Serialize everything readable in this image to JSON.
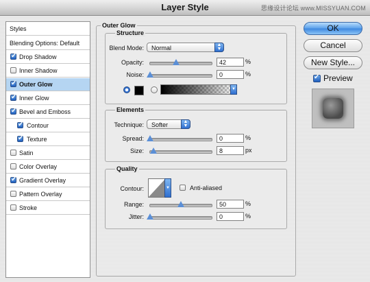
{
  "window": {
    "title": "Layer Style",
    "watermark": "思缘设计论坛 www.MISSYUAN.COM"
  },
  "sidebar": {
    "header": "Styles",
    "blending": "Blending Options: Default",
    "items": [
      {
        "label": "Drop Shadow",
        "checked": true
      },
      {
        "label": "Inner Shadow",
        "checked": false
      },
      {
        "label": "Outer Glow",
        "checked": true,
        "selected": true
      },
      {
        "label": "Inner Glow",
        "checked": true
      },
      {
        "label": "Bevel and Emboss",
        "checked": true
      },
      {
        "label": "Contour",
        "checked": true,
        "indent": true
      },
      {
        "label": "Texture",
        "checked": true,
        "indent": true
      },
      {
        "label": "Satin",
        "checked": false
      },
      {
        "label": "Color Overlay",
        "checked": false
      },
      {
        "label": "Gradient Overlay",
        "checked": true
      },
      {
        "label": "Pattern Overlay",
        "checked": false
      },
      {
        "label": "Stroke",
        "checked": false
      }
    ]
  },
  "outer_glow": {
    "title": "Outer Glow",
    "structure": {
      "title": "Structure",
      "blend_mode_label": "Blend Mode:",
      "blend_mode": "Normal",
      "opacity_label": "Opacity:",
      "opacity": "42",
      "opacity_unit": "%",
      "noise_label": "Noise:",
      "noise": "0",
      "noise_unit": "%"
    },
    "elements": {
      "title": "Elements",
      "technique_label": "Technique:",
      "technique": "Softer",
      "spread_label": "Spread:",
      "spread": "0",
      "spread_unit": "%",
      "size_label": "Size:",
      "size": "8",
      "size_unit": "px"
    },
    "quality": {
      "title": "Quality",
      "contour_label": "Contour:",
      "antialiased_label": "Anti-aliased",
      "range_label": "Range:",
      "range": "50",
      "range_unit": "%",
      "jitter_label": "Jitter:",
      "jitter": "0",
      "jitter_unit": "%"
    }
  },
  "buttons": {
    "ok": "OK",
    "cancel": "Cancel",
    "new_style": "New Style...",
    "preview": "Preview"
  },
  "colors": {
    "accent": "#3c87df",
    "selection": "#b5d5f2"
  }
}
